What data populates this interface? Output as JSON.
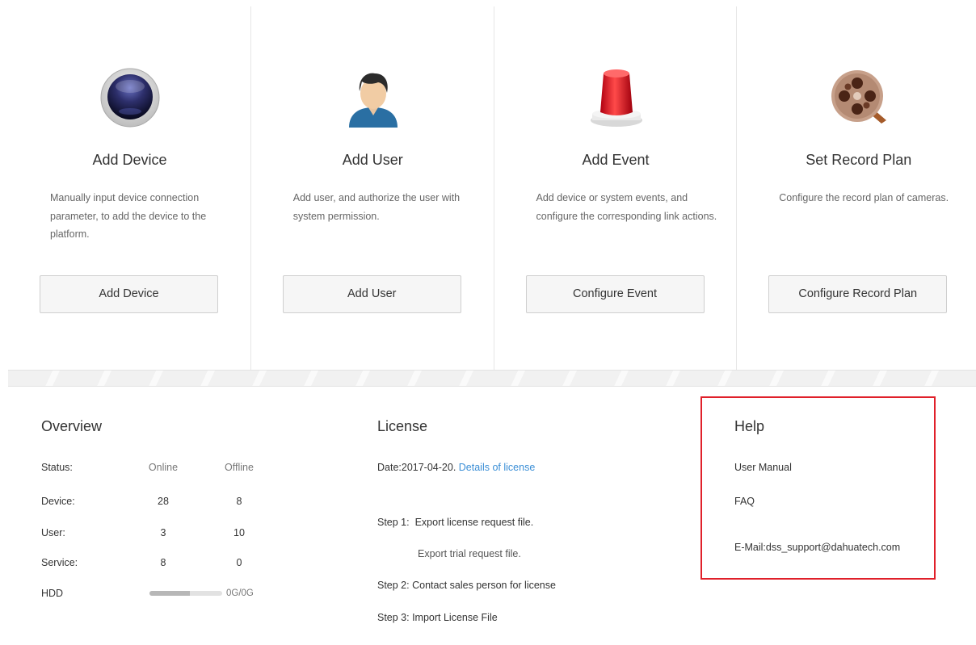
{
  "cards": [
    {
      "title": "Add Device",
      "desc": "Manually input device connection parameter, to add the device to the platform.",
      "button": "Add Device"
    },
    {
      "title": "Add User",
      "desc": "Add user, and authorize the user with system permission.",
      "button": "Add User"
    },
    {
      "title": "Add Event",
      "desc": "Add device or system events, and configure the corresponding link actions.",
      "button": "Configure Event"
    },
    {
      "title": "Set Record Plan",
      "desc": "Configure the record plan of cameras.",
      "button": "Configure Record Plan"
    }
  ],
  "overview": {
    "title": "Overview",
    "headers": {
      "status": "Status:",
      "online": "Online",
      "offline": "Offline"
    },
    "rows": [
      {
        "label": "Device:",
        "online": "28",
        "offline": "8"
      },
      {
        "label": "User:",
        "online": "3",
        "offline": "10"
      },
      {
        "label": "Service:",
        "online": "8",
        "offline": "0"
      }
    ],
    "hdd": {
      "label": "HDD",
      "value": "0G/0G",
      "fill_fraction": 0.55
    }
  },
  "license": {
    "title": "License",
    "date": "Date:2017-04-20.",
    "details_link": "Details of license",
    "step1_label": "Step 1:",
    "step1_text": "Export license request file.",
    "trial": "Export trial request file.",
    "step2": "Step 2: Contact sales person for license",
    "step3": "Step 3: Import License File"
  },
  "help": {
    "title": "Help",
    "manual": "User Manual",
    "faq": "FAQ",
    "email": "E-Mail:dss_support@dahuatech.com"
  },
  "colors": {
    "link": "#3a8ed6",
    "highlight_border": "#e0202a"
  }
}
